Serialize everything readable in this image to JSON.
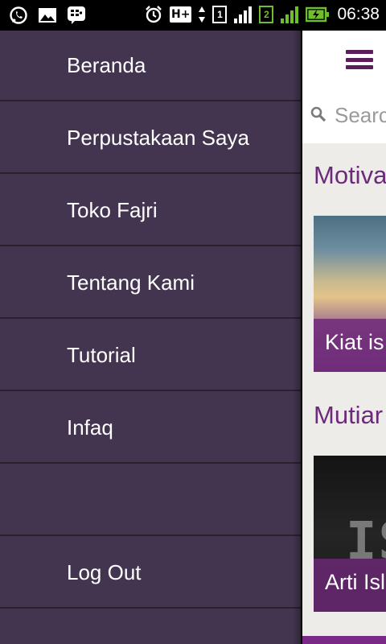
{
  "status_bar": {
    "time": "06:38",
    "network_badge": "H+",
    "sim1_label": "1",
    "sim2_label": "2"
  },
  "drawer": {
    "items": [
      {
        "label": "Beranda"
      },
      {
        "label": "Perpustakaan Saya"
      },
      {
        "label": "Toko Fajri"
      },
      {
        "label": "Tentang Kami"
      },
      {
        "label": "Tutorial"
      },
      {
        "label": "Infaq"
      },
      {
        "label": ""
      },
      {
        "label": "Log Out"
      }
    ]
  },
  "main": {
    "search": {
      "placeholder": "Searc"
    },
    "sections": [
      {
        "title": "Motiva",
        "card_caption": "Kiat is"
      },
      {
        "title": "Mutiar",
        "card_caption": "Arti Isl",
        "card_image_text": "IS"
      }
    ]
  },
  "colors": {
    "drawer_bg": "#43344f",
    "accent": "#6c2a7a",
    "hamburger": "#5a1f5a"
  }
}
